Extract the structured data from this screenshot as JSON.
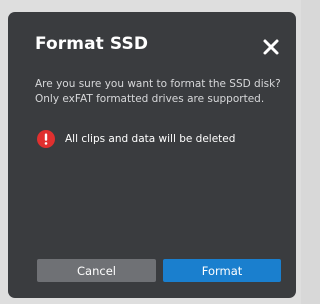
{
  "dialog": {
    "title": "Format SSD",
    "close_icon": "close-icon",
    "message_line1": "Are you sure you want to format the SSD disk?",
    "message_line2": "Only exFAT formatted drives are supported.",
    "warning_icon": "alert-icon",
    "warning_text": "All clips and data will be deleted",
    "cancel_label": "Cancel",
    "format_label": "Format"
  },
  "colors": {
    "dialog_background": "#3a3c3f",
    "cancel_button": "#6f7175",
    "format_button": "#1a7fce",
    "warning_icon": "#e0302f"
  }
}
